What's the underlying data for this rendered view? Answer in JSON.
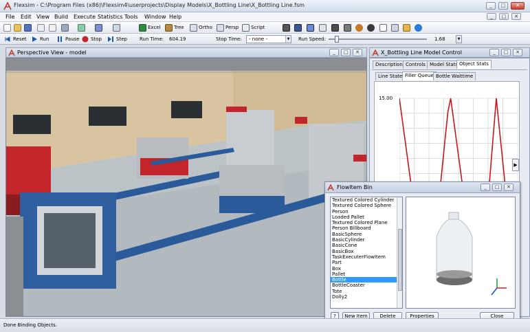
{
  "window": {
    "title": "Flexsim - C:\\Program Files (x86)\\Flexsim4\\userprojects\\Display Models\\X_Bottling Line\\X_Bottling Line.fsm"
  },
  "menu": [
    "File",
    "Edit",
    "View",
    "Build",
    "Execute",
    "Statistics",
    "Tools",
    "Window",
    "Help"
  ],
  "toolbar": {
    "excel": "Excel",
    "tree": "Tree",
    "ortho": "Ortho",
    "persp": "Persp",
    "script": "Script"
  },
  "runbar": {
    "reset": "Reset",
    "run": "Run",
    "pause": "Pause",
    "stop": "Stop",
    "step": "Step",
    "run_time_label": "Run Time:",
    "run_time_value": "604.19",
    "stop_time_label": "Stop Time:",
    "stop_time_value": "- none -",
    "run_speed_label": "Run Speed:",
    "run_speed_value": "1.68"
  },
  "viewport": {
    "title": "Perspective View - model"
  },
  "control": {
    "title": "X_Bottling Line Model Control",
    "tabs": [
      "Description",
      "Controls",
      "Model Stats",
      "Object Stats"
    ],
    "subtabs": [
      "Line State",
      "Filler Queue",
      "Bottle Waittime"
    ],
    "chart_ymax_label": "15.00"
  },
  "chart_data": {
    "type": "line",
    "title": "",
    "xlabel": "",
    "ylabel": "",
    "ylim": [
      0,
      15
    ],
    "series": [
      {
        "values": [
          15,
          13.5,
          12,
          10.5,
          9,
          7.5,
          6,
          4.5,
          3,
          1.5,
          0.5,
          2,
          4,
          6,
          8,
          10,
          12,
          14,
          15,
          13.5,
          12,
          10.5,
          9,
          7.5,
          6,
          4.5,
          3,
          1.5,
          0.5,
          2.5,
          5,
          7.5,
          10,
          12.5,
          15,
          13,
          11,
          9,
          7,
          5,
          3,
          1.5
        ]
      }
    ]
  },
  "flowbin": {
    "title": "FlowItem Bin",
    "items": [
      "Textured Colored Cylinder",
      "Textured Colored Sphere",
      "Person",
      "Loaded Pallet",
      "Textured Colored Plane",
      "Person Billboard",
      "BasicSphere",
      "BasicCylinder",
      "BasicCone",
      "BasicBox",
      "TaskExecuterFlowItem",
      "Part",
      "Box",
      "Pallet",
      "Bottle",
      "BottleCoaster",
      "Tote",
      "Dolly2"
    ],
    "selected": "Bottle",
    "buttons": {
      "new": "New Item",
      "delete": "Delete Item",
      "properties": "Properties",
      "close": "Close"
    }
  },
  "status": "Done Binding Objects."
}
